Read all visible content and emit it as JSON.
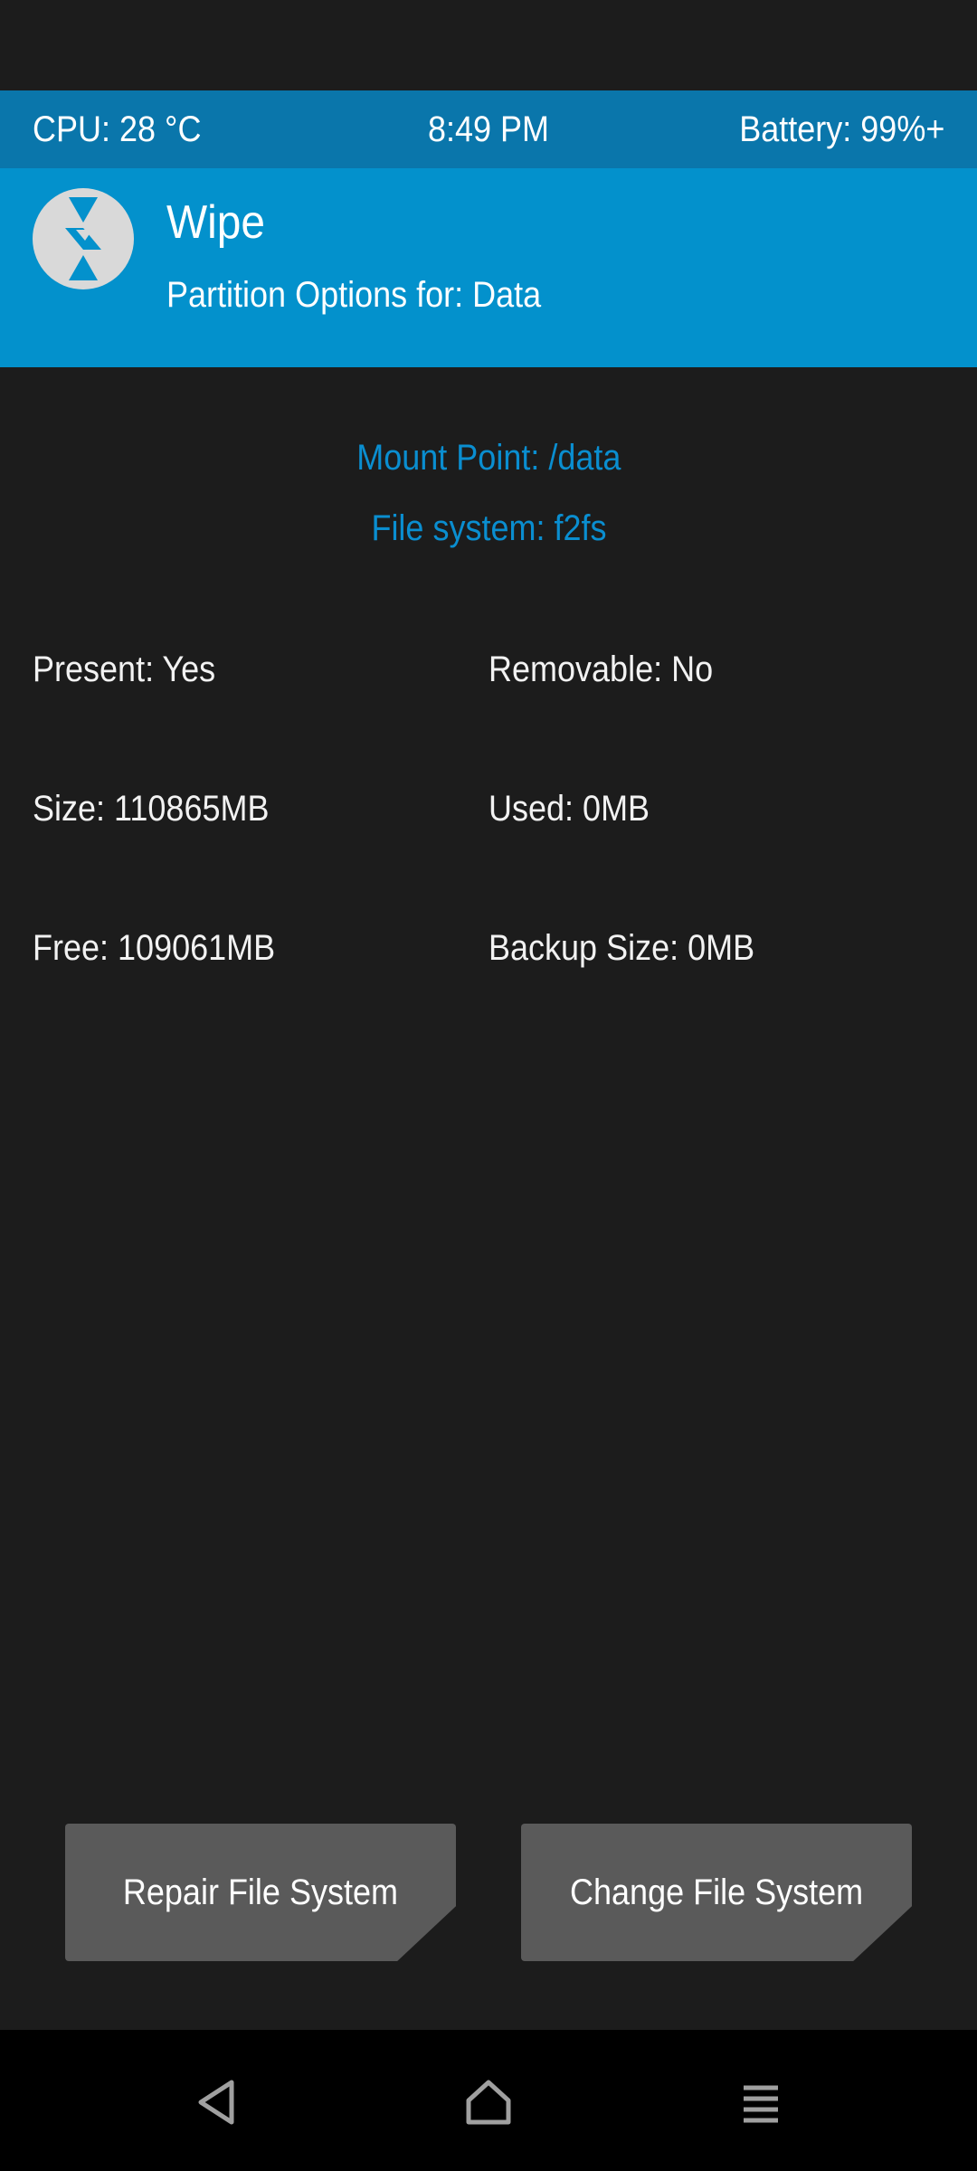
{
  "status_bar": {
    "cpu": "CPU: 28 °C",
    "time": "8:49 PM",
    "battery": "Battery: 99%+"
  },
  "header": {
    "logo_icon": "twrp-logo-icon",
    "title": "Wipe",
    "subtitle": "Partition Options for: Data"
  },
  "partition": {
    "mount_point": "Mount Point: /data",
    "file_system": "File system: f2fs",
    "present": "Present: Yes",
    "removable": "Removable: No",
    "size": "Size: 110865MB",
    "used": "Used: 0MB",
    "free": "Free: 109061MB",
    "backup_size": "Backup Size: 0MB"
  },
  "actions": {
    "repair_label": "Repair File System",
    "change_label": "Change File System"
  },
  "nav_bar": {
    "back_icon": "back-triangle-icon",
    "home_icon": "home-icon",
    "menu_icon": "menu-lines-icon"
  },
  "colors": {
    "status_bar_bg": "#0a76ab",
    "header_bg": "#0391cc",
    "accent_text": "#0a8ed0",
    "background": "#1c1c1c",
    "button_bg": "#5a5a5a",
    "nav_bar_bg": "#000000"
  }
}
